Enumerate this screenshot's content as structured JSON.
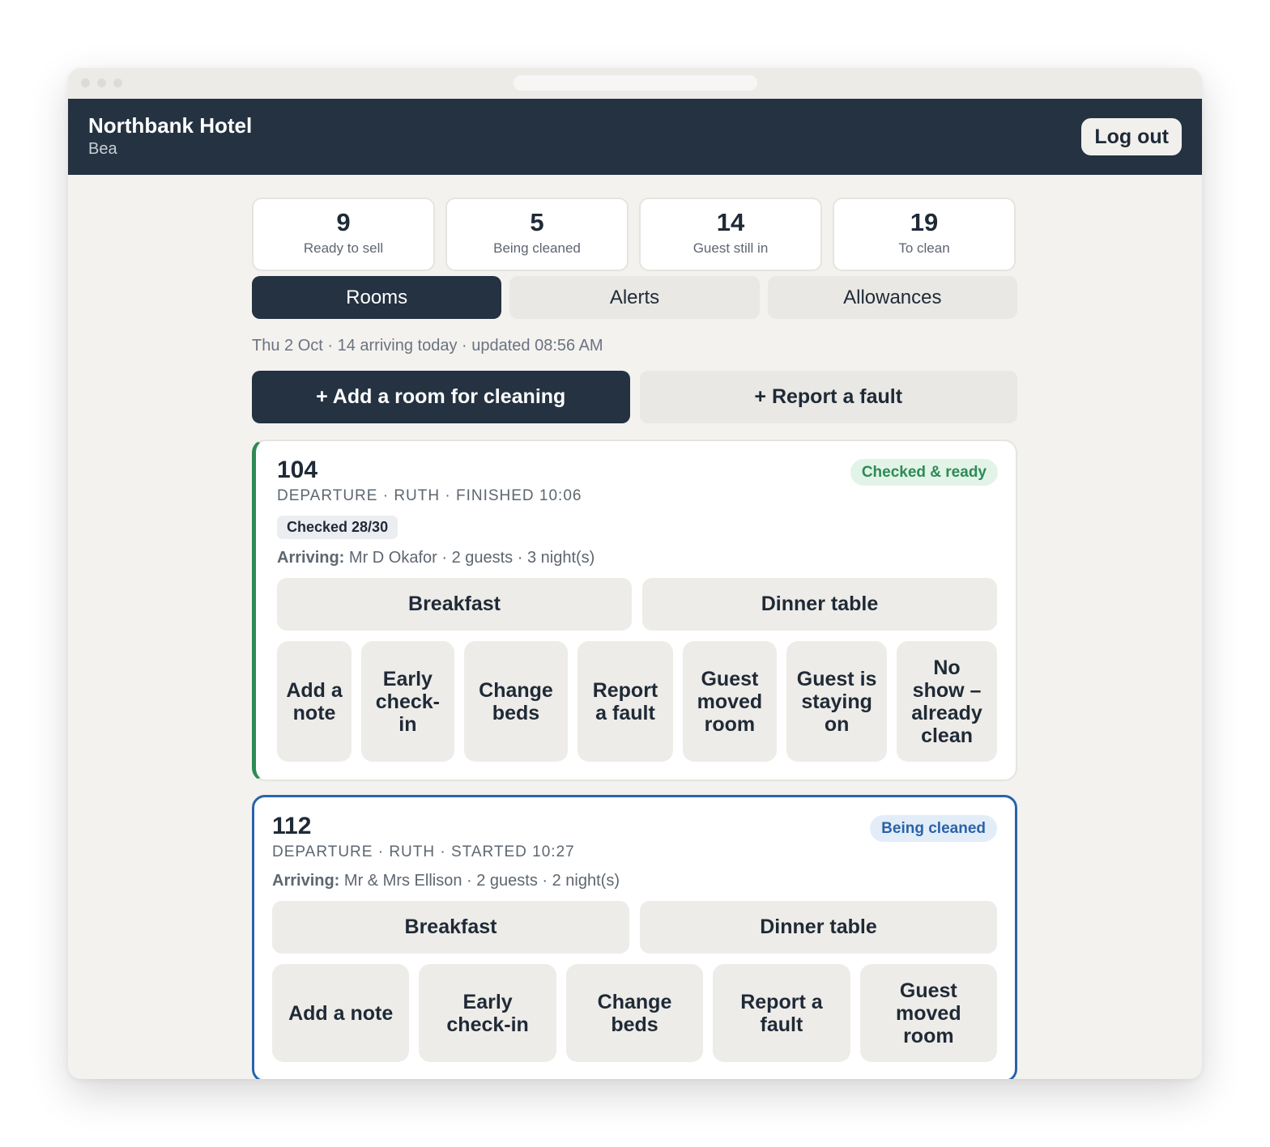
{
  "header": {
    "hotel": "Northbank Hotel",
    "user": "Bea",
    "logout_label": "Log out"
  },
  "stats": [
    {
      "value": "9",
      "label": "Ready to sell"
    },
    {
      "value": "5",
      "label": "Being cleaned"
    },
    {
      "value": "14",
      "label": "Guest still in"
    },
    {
      "value": "19",
      "label": "To clean"
    }
  ],
  "tabs": [
    {
      "label": "Rooms",
      "active": true
    },
    {
      "label": "Alerts",
      "active": false
    },
    {
      "label": "Allowances",
      "active": false
    }
  ],
  "subinfo": "Thu 2 Oct · 14 arriving today · updated 08:56 AM",
  "actions": {
    "add_room": "+ Add a room for cleaning",
    "report_fault": "+ Report a fault"
  },
  "rooms": [
    {
      "number": "104",
      "meta": "DEPARTURE · RUTH · FINISHED 10:06",
      "status": "Checked & ready",
      "status_color": "#2e8a55",
      "checked": "Checked 28/30",
      "arriving_label": "Arriving:",
      "arriving_text": "Mr D Okafor · 2 guests · 3 night(s)",
      "meals": [
        "Breakfast",
        "Dinner table"
      ],
      "options": [
        "Add a note",
        "Early check-in",
        "Change beds",
        "Report a fault",
        "Guest moved room",
        "Guest is staying on",
        "No show – already clean"
      ]
    },
    {
      "number": "112",
      "meta": "DEPARTURE · RUTH · STARTED 10:27",
      "status": "Being cleaned",
      "status_color": "#2a63a8",
      "arriving_label": "Arriving:",
      "arriving_text": "Mr & Mrs Ellison · 2 guests · 2 night(s)",
      "meals": [
        "Breakfast",
        "Dinner table"
      ],
      "options": [
        "Add a note",
        "Early check-in",
        "Change beds",
        "Report a fault",
        "Guest moved room"
      ]
    }
  ],
  "colors": {
    "navy": "#243241",
    "green": "#2e8a55",
    "blue": "#2a63a8",
    "background": "#f3f2ef"
  }
}
